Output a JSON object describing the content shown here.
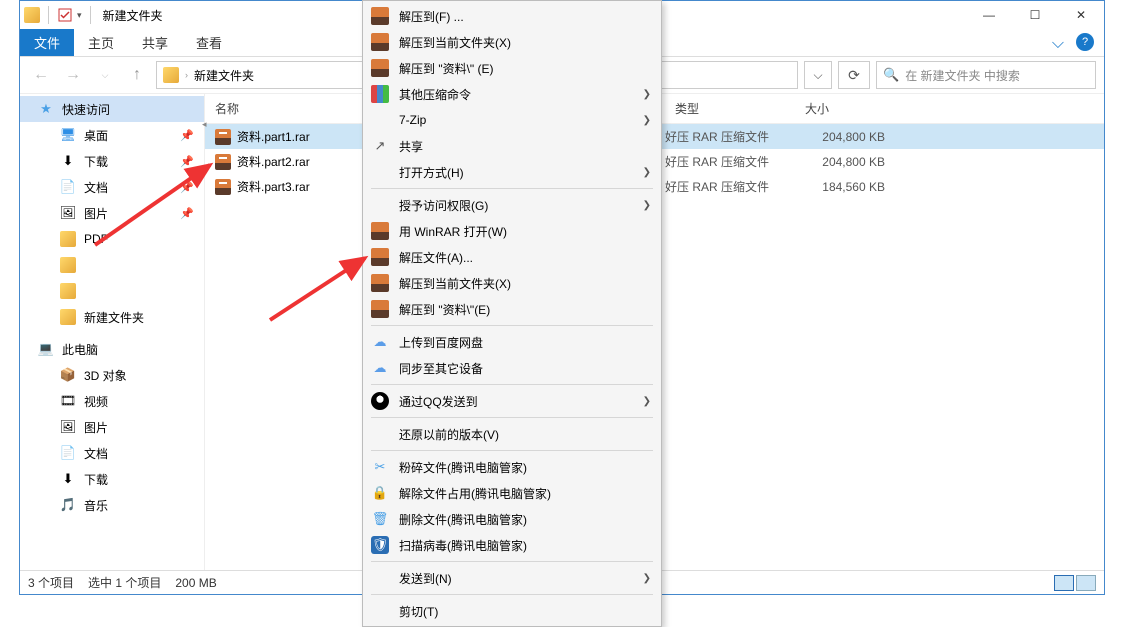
{
  "titlebar": {
    "title": "新建文件夹"
  },
  "ribbon": {
    "file": "文件",
    "tabs": [
      "主页",
      "共享",
      "查看"
    ]
  },
  "addr": {
    "folder": "新建文件夹",
    "refresh_icon": "refresh",
    "dropdown_icon": "chevron-down"
  },
  "search": {
    "placeholder": "在 新建文件夹 中搜索"
  },
  "columns": {
    "name": "名称",
    "type": "类型",
    "size": "大小"
  },
  "sidebar": {
    "quick": "快速访问",
    "items": [
      {
        "label": "桌面",
        "icon": "desktop",
        "pin": true
      },
      {
        "label": "下载",
        "icon": "download",
        "pin": true
      },
      {
        "label": "文档",
        "icon": "document",
        "pin": true
      },
      {
        "label": "图片",
        "icon": "picture",
        "pin": true
      },
      {
        "label": "PDF",
        "icon": "folder",
        "pin": false
      },
      {
        "label": "",
        "icon": "folder",
        "pin": false
      },
      {
        "label": "",
        "icon": "folder",
        "pin": false
      },
      {
        "label": "新建文件夹",
        "icon": "folder",
        "pin": false
      }
    ],
    "pc": "此电脑",
    "pcitems": [
      {
        "label": "3D 对象",
        "icon": "3d"
      },
      {
        "label": "视频",
        "icon": "video"
      },
      {
        "label": "图片",
        "icon": "picture"
      },
      {
        "label": "文档",
        "icon": "document"
      },
      {
        "label": "下载",
        "icon": "download"
      },
      {
        "label": "音乐",
        "icon": "music"
      }
    ]
  },
  "files": [
    {
      "name": "资料.part1.rar",
      "type": "好压 RAR 压缩文件",
      "size": "204,800 KB",
      "sel": true
    },
    {
      "name": "资料.part2.rar",
      "type": "好压 RAR 压缩文件",
      "size": "204,800 KB",
      "sel": false
    },
    {
      "name": "资料.part3.rar",
      "type": "好压 RAR 压缩文件",
      "size": "184,560 KB",
      "sel": false
    }
  ],
  "status": {
    "count": "3 个项目",
    "selected": "选中 1 个项目",
    "size": "200 MB"
  },
  "menu": {
    "g1": [
      {
        "label": "解压到(F) ...",
        "icon": "rar"
      },
      {
        "label": "解压到当前文件夹(X)",
        "icon": "rar"
      },
      {
        "label": "解压到 \"资料\\\" (E)",
        "icon": "rar"
      },
      {
        "label": "其他压缩命令",
        "icon": "books",
        "sub": true
      },
      {
        "label": "7-Zip",
        "icon": "",
        "sub": true
      },
      {
        "label": "共享",
        "icon": "share"
      },
      {
        "label": "打开方式(H)",
        "icon": "",
        "sub": true
      }
    ],
    "g2": [
      {
        "label": "授予访问权限(G)",
        "icon": "",
        "sub": true
      },
      {
        "label": "用 WinRAR 打开(W)",
        "icon": "rar"
      },
      {
        "label": "解压文件(A)...",
        "icon": "rar"
      },
      {
        "label": "解压到当前文件夹(X)",
        "icon": "rar"
      },
      {
        "label": "解压到 \"资料\\\"(E)",
        "icon": "rar"
      }
    ],
    "g3": [
      {
        "label": "上传到百度网盘",
        "icon": "cloud"
      },
      {
        "label": "同步至其它设备",
        "icon": "cloud"
      }
    ],
    "g4": [
      {
        "label": "通过QQ发送到",
        "icon": "qq",
        "sub": true
      }
    ],
    "g5": [
      {
        "label": "还原以前的版本(V)",
        "icon": ""
      }
    ],
    "g6": [
      {
        "label": "粉碎文件(腾讯电脑管家)",
        "icon": "shred"
      },
      {
        "label": "解除文件占用(腾讯电脑管家)",
        "icon": "lock"
      },
      {
        "label": "删除文件(腾讯电脑管家)",
        "icon": "del"
      },
      {
        "label": "扫描病毒(腾讯电脑管家)",
        "icon": "scan"
      }
    ],
    "g7": [
      {
        "label": "发送到(N)",
        "icon": "",
        "sub": true
      }
    ],
    "g8": [
      {
        "label": "剪切(T)",
        "icon": ""
      }
    ]
  }
}
